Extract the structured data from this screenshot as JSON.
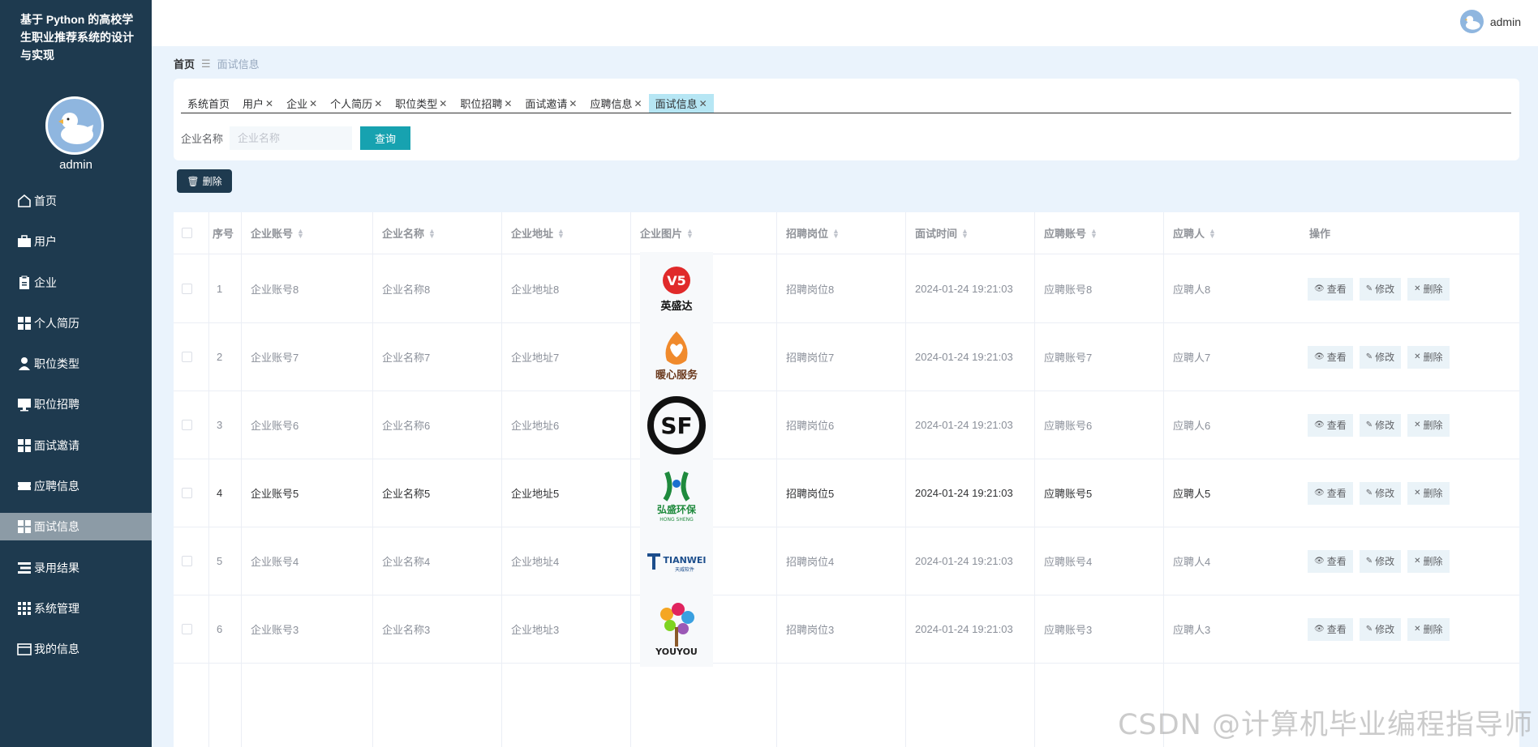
{
  "app": {
    "title": "基于 Python 的高校学生职业推荐系统的设计与实现"
  },
  "sidebar": {
    "username": "admin",
    "items": [
      {
        "label": "首页",
        "icon": "home-icon"
      },
      {
        "label": "用户",
        "icon": "briefcase-icon"
      },
      {
        "label": "企业",
        "icon": "clipboard-icon"
      },
      {
        "label": "个人简历",
        "icon": "grid-icon"
      },
      {
        "label": "职位类型",
        "icon": "person-icon"
      },
      {
        "label": "职位招聘",
        "icon": "monitor-icon"
      },
      {
        "label": "面试邀请",
        "icon": "grid-icon"
      },
      {
        "label": "应聘信息",
        "icon": "ticket-icon"
      },
      {
        "label": "面试信息",
        "icon": "grid-icon"
      },
      {
        "label": "录用结果",
        "icon": "list-icon"
      },
      {
        "label": "系统管理",
        "icon": "apps-icon"
      },
      {
        "label": "我的信息",
        "icon": "card-icon"
      }
    ],
    "active": "面试信息"
  },
  "header": {
    "username": "admin"
  },
  "breadcrumb": {
    "home": "首页",
    "current": "面试信息"
  },
  "tabs": [
    {
      "label": "系统首页",
      "closable": false
    },
    {
      "label": "用户",
      "closable": true
    },
    {
      "label": "企业",
      "closable": true
    },
    {
      "label": "个人简历",
      "closable": true
    },
    {
      "label": "职位类型",
      "closable": true
    },
    {
      "label": "职位招聘",
      "closable": true
    },
    {
      "label": "面试邀请",
      "closable": true
    },
    {
      "label": "应聘信息",
      "closable": true
    },
    {
      "label": "面试信息",
      "closable": true,
      "active": true
    }
  ],
  "search": {
    "label": "企业名称",
    "placeholder": "企业名称",
    "value": "",
    "button": "查询"
  },
  "toolbar": {
    "delete_label": "删除"
  },
  "table": {
    "columns": [
      "序号",
      "企业账号",
      "企业名称",
      "企业地址",
      "企业图片",
      "招聘岗位",
      "面试时间",
      "应聘账号",
      "应聘人",
      "操作"
    ],
    "actions": {
      "view": "查看",
      "edit": "修改",
      "delete": "删除"
    },
    "rows": [
      {
        "idx": "1",
        "account": "企业账号8",
        "name": "企业名称8",
        "address": "企业地址8",
        "logo": "英盛达",
        "position": "招聘岗位8",
        "time": "2024-01-24 19:21:03",
        "applicant_account": "应聘账号8",
        "applicant": "应聘人8"
      },
      {
        "idx": "2",
        "account": "企业账号7",
        "name": "企业名称7",
        "address": "企业地址7",
        "logo": "暖心服务",
        "position": "招聘岗位7",
        "time": "2024-01-24 19:21:03",
        "applicant_account": "应聘账号7",
        "applicant": "应聘人7"
      },
      {
        "idx": "3",
        "account": "企业账号6",
        "name": "企业名称6",
        "address": "企业地址6",
        "logo": "SF",
        "position": "招聘岗位6",
        "time": "2024-01-24 19:21:03",
        "applicant_account": "应聘账号6",
        "applicant": "应聘人6"
      },
      {
        "idx": "4",
        "account": "企业账号5",
        "name": "企业名称5",
        "address": "企业地址5",
        "logo": "弘盛环保",
        "position": "招聘岗位5",
        "time": "2024-01-24 19:21:03",
        "applicant_account": "应聘账号5",
        "applicant": "应聘人5"
      },
      {
        "idx": "5",
        "account": "企业账号4",
        "name": "企业名称4",
        "address": "企业地址4",
        "logo": "TIANWEI",
        "position": "招聘岗位4",
        "time": "2024-01-24 19:21:03",
        "applicant_account": "应聘账号4",
        "applicant": "应聘人4"
      },
      {
        "idx": "6",
        "account": "企业账号3",
        "name": "企业名称3",
        "address": "企业地址3",
        "logo": "YOUYOU",
        "position": "招聘岗位3",
        "time": "2024-01-24 19:21:03",
        "applicant_account": "应聘账号3",
        "applicant": "应聘人3"
      }
    ]
  },
  "watermark": "CSDN @计算机毕业编程指导师"
}
